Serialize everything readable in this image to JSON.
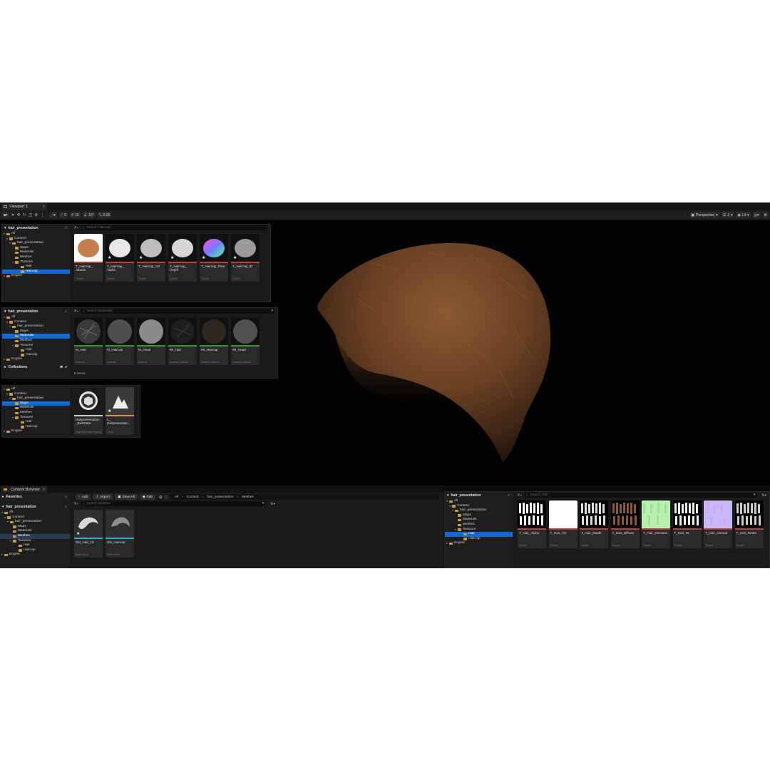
{
  "window": {
    "tab_title": "Viewport 1",
    "close": "×"
  },
  "toolbar": {
    "snap_rot": "10°",
    "snap_scale": "0.25",
    "snap_grid": "10",
    "snap_label": "0",
    "view_mode": "Perspective",
    "lit": "Lit",
    "grid_count": "1"
  },
  "panel1": {
    "header": "hair_presentation",
    "search_placeholder": "Search Haircap",
    "tree": [
      "All",
      "Content",
      "hair_presentation",
      "Maps",
      "Materials",
      "Meshes",
      "Textures",
      "Hair",
      "Haircap",
      "Engine"
    ],
    "tiles": [
      {
        "name": "T_Haircap_\nAlbedo",
        "type": "Texture"
      },
      {
        "name": "T_Haircap_\nAlpha",
        "type": "Texture"
      },
      {
        "name": "T_Haircap_AO",
        "type": "Texture"
      },
      {
        "name": "T_Haircap_\nDepth",
        "type": "Texture"
      },
      {
        "name": "T_Haircap_Flow",
        "type": "Texture"
      },
      {
        "name": "T_Haircap_ID",
        "type": "Texture"
      }
    ]
  },
  "panel2": {
    "header": "hair_presentation",
    "search_placeholder": "Search Materials",
    "tree": [
      "All",
      "Content",
      "hair_presentation",
      "Maps",
      "Materials",
      "Meshes",
      "Textures",
      "Hair",
      "Haircap",
      "Engine"
    ],
    "tiles": [
      {
        "name": "M_Hair",
        "type": "Material"
      },
      {
        "name": "M_Haircap",
        "type": "Material"
      },
      {
        "name": "M_Head",
        "type": "Material"
      },
      {
        "name": "MI_Hair",
        "type": "Material Instance"
      },
      {
        "name": "MI_Haircap",
        "type": "Material Instance"
      },
      {
        "name": "MI_Head",
        "type": "Material Instance"
      }
    ],
    "collections": "Collections",
    "item_count": "6 items"
  },
  "panel3": {
    "tree": [
      "All",
      "Content",
      "hair_presentation",
      "Maps",
      "Materials",
      "Meshes",
      "Textures",
      "Hair",
      "Haircap",
      "Engine"
    ],
    "tiles": [
      {
        "name": "Hairpresentation\n_BuiltData",
        "type": "Map Build Data Registry"
      },
      {
        "name": "L_\nHairpresentati...",
        "type": "Level"
      }
    ]
  },
  "content_browser": {
    "tab_title": "Content Browser",
    "favorites": "Favorites",
    "header": "hair_presentation",
    "add": "Add",
    "import": "Import",
    "save_all": "Save All",
    "fab": "Fab",
    "breadcrumb": [
      "All",
      "Content",
      "hair_presentation",
      "Meshes"
    ],
    "search_placeholder": "Search Meshes",
    "tree": [
      "All",
      "Content",
      "hair_presentation",
      "Maps",
      "Materials",
      "Meshes",
      "Textures",
      "Hair",
      "Haircap",
      "Engine"
    ],
    "tiles": [
      {
        "name": "SM_Hair_19",
        "type": "Static Mesh"
      },
      {
        "name": "SM_Haircap",
        "type": "Static Mesh"
      }
    ]
  },
  "panel4": {
    "header": "hair_presentation",
    "search_placeholder": "Search Hair",
    "tree": [
      "All",
      "Content",
      "hair_presentation",
      "Maps",
      "Materials",
      "Meshes",
      "Textures",
      "Hair",
      "Haircap",
      "Engine"
    ],
    "tiles": [
      {
        "name": "T_Hair_Alpha",
        "type": "Texture"
      },
      {
        "name": "T_Hair_AO",
        "type": "Texture"
      },
      {
        "name": "T_Hair_Depth",
        "type": "Texture"
      },
      {
        "name": "T_Hair_Diffuse",
        "type": "Texture"
      },
      {
        "name": "T_Hair_Direction",
        "type": "Texture"
      },
      {
        "name": "T_Hair_ID",
        "type": "Texture"
      },
      {
        "name": "T_Hair_Normal",
        "type": "Texture"
      },
      {
        "name": "T_Hair_Roots",
        "type": "Texture"
      }
    ]
  },
  "colors": {
    "accent": "#0e6ad6",
    "texture_bar": "#c23a3a",
    "material_bar": "#3d9b3d",
    "level_bar": "#e0962a",
    "mesh_bar": "#25b3d1",
    "folder": "#c79a45"
  }
}
